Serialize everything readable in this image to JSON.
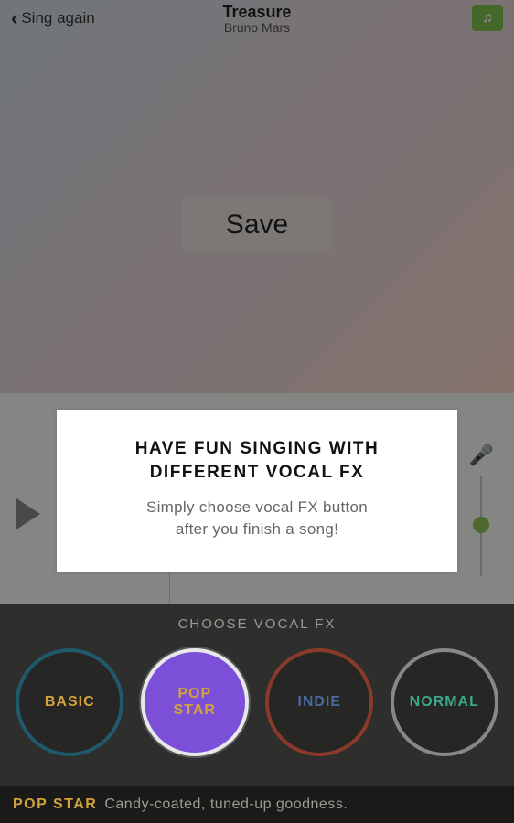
{
  "header": {
    "back_label": "Sing again",
    "song_title": "Treasure",
    "artist": "Bruno Mars"
  },
  "main": {
    "save_label": "Save"
  },
  "tooltip": {
    "title_line1": "HAVE FUN SINGING WITH",
    "title_line2": "DIFFERENT VOCAL FX",
    "body_line1": "Simply choose vocal FX button",
    "body_line2": "after you finish a song!"
  },
  "fx": {
    "heading": "CHOOSE VOCAL FX",
    "options": [
      {
        "label": "BASIC"
      },
      {
        "label": "POP STAR"
      },
      {
        "label": "INDIE"
      },
      {
        "label": "NORMAL"
      }
    ],
    "selected": {
      "name": "POP STAR",
      "description": "Candy-coated, tuned-up goodness."
    }
  }
}
